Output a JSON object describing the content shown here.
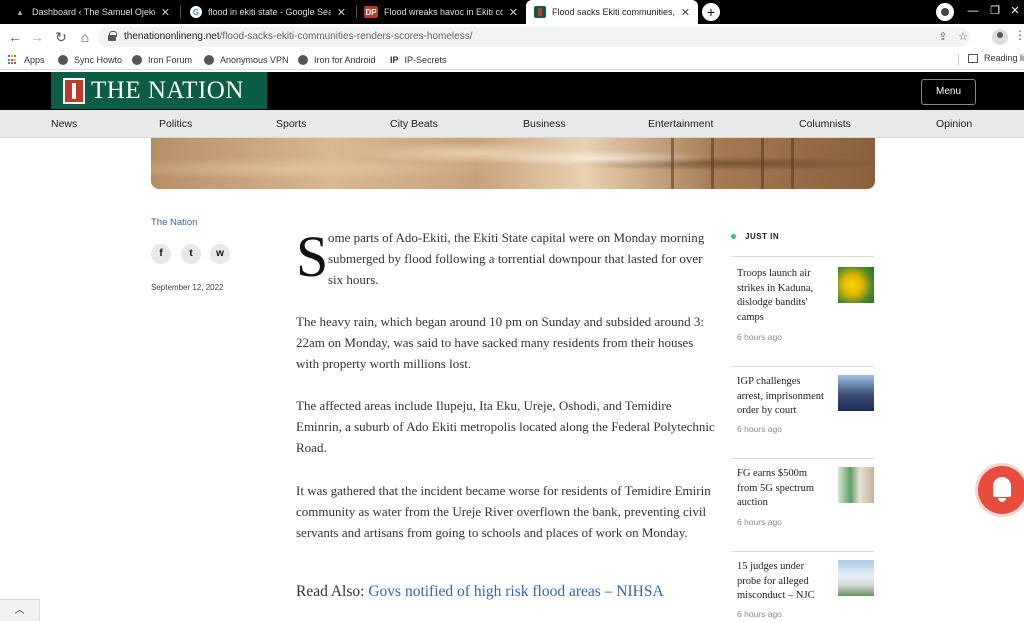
{
  "browser": {
    "tabs": [
      {
        "title": "Dashboard ‹ The Samuel Ojekwe",
        "favicon": "wordpress-dashboard-icon",
        "active": false
      },
      {
        "title": "flood in ekiti state - Google Search",
        "favicon": "google-icon",
        "active": false
      },
      {
        "title": "Flood wreaks havoc in Ekiti community",
        "favicon": "dp-icon",
        "favicon_text": "DP",
        "active": false
      },
      {
        "title": "Flood sacks Ekiti communities, rend",
        "favicon": "the-nation-icon",
        "active": true
      }
    ],
    "new_tab": "+",
    "url_domain": "thenationonlineng.net",
    "url_path": "/flood-sacks-ekiti-communities-renders-scores-homeless/",
    "bookmarks": [
      {
        "label": "Apps",
        "icon": "apps-grid-icon"
      },
      {
        "label": "Sync Howto",
        "icon": "globe-icon"
      },
      {
        "label": "Iron Forum",
        "icon": "globe-icon"
      },
      {
        "label": "Anonymous VPN",
        "icon": "globe-icon"
      },
      {
        "label": "Iron for Android",
        "icon": "globe-icon"
      },
      {
        "label": "IP-Secrets",
        "icon": "ip-icon",
        "icon_text": "IP"
      }
    ],
    "reading_list": "Reading list"
  },
  "site": {
    "logo": "THE NATION",
    "menu_label": "Menu",
    "nav": [
      "News",
      "Politics",
      "Sports",
      "City Beats",
      "Business",
      "Entertainment",
      "Columnists",
      "Opinion"
    ],
    "brand_green": "#0b5e45"
  },
  "article": {
    "author": "The Nation",
    "date": "September 12, 2022",
    "dropcap": "S",
    "p1": "ome parts of Ado-Ekiti, the Ekiti State capital were on Monday morning submerged by flood following a torrential downpour that lasted for over six hours.",
    "paragraphs": [
      "The heavy rain, which began around 10 pm on Sunday and subsided around 3: 22am on Monday, was said to have sacked many residents from their houses with property worth millions lost.",
      "The affected areas include Ilupeju, Ita Eku, Ureje, Oshodi, and Temidire Eminrin, a suburb of Ado Ekiti metropolis located along the Federal Polytechnic Road.",
      "It was gathered that the incident became worse for residents of Temidire Emirin community as water from the Ureje River overflown the bank, preventing civil servants and artisans from going to schools and places of work on Monday."
    ],
    "read_also_label": "Read Also:",
    "read_also_link": "Govs notified of high risk flood areas – NIHSA"
  },
  "share": [
    {
      "icon": "facebook-icon",
      "glyph": "f"
    },
    {
      "icon": "twitter-icon",
      "glyph": "t"
    },
    {
      "icon": "whatsapp-icon",
      "glyph": "w"
    }
  ],
  "sidebar": {
    "heading": "JUST IN",
    "items": [
      {
        "title": "Troops launch air strikes in Kaduna, dislodge bandits' camps",
        "time": "6 hours ago"
      },
      {
        "title": "IGP challenges arrest, imprisonment order by court",
        "time": "6 hours ago"
      },
      {
        "title": "FG earns $500m from 5G spectrum auction",
        "time": "6 hours ago"
      },
      {
        "title": "15 judges under probe for alleged misconduct – NJC",
        "time": "6 hours ago"
      }
    ]
  }
}
